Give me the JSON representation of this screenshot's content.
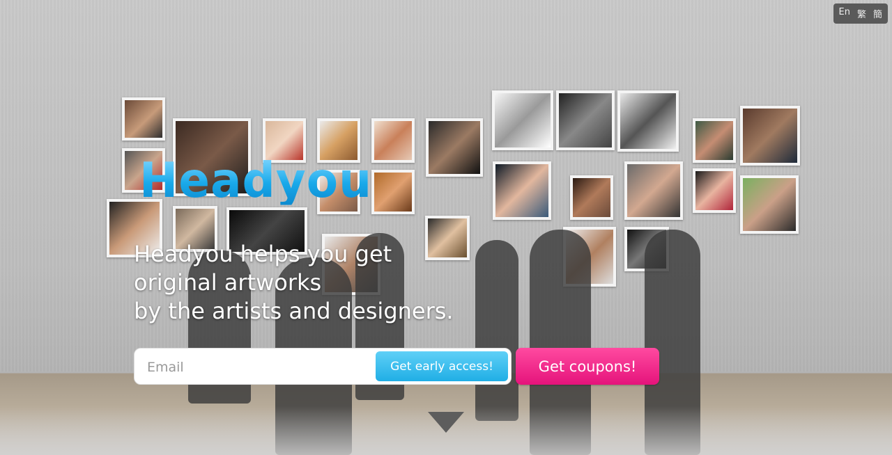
{
  "header": {
    "languages": [
      "En",
      "繁",
      "簡"
    ]
  },
  "hero": {
    "logo_text": "Headyou",
    "tagline_lines": [
      "Headyou helps you get",
      "original artworks",
      "by the artists and designers."
    ]
  },
  "signup": {
    "email_placeholder": "Email",
    "early_access_label": "Get early access!",
    "coupons_label": "Get coupons!"
  },
  "icons": {
    "scroll_down": "down-triangle-icon"
  },
  "colors": {
    "logo": "#35b9ef",
    "early_button": "#20aee5",
    "coupon_button": "#e5137b",
    "lang_bar": "#5a5a5a"
  }
}
